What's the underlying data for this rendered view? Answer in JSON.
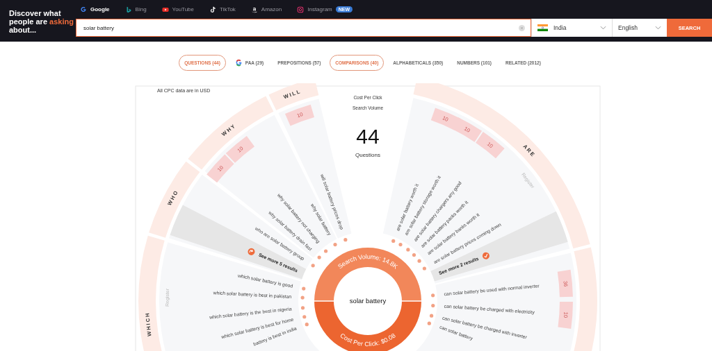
{
  "header": {
    "tagline": {
      "before": "Discover what people are ",
      "highlight": "asking",
      "after": " about..."
    },
    "engines": [
      {
        "label": "Google",
        "kind": "google",
        "selected": true
      },
      {
        "label": "Bing",
        "kind": "bing",
        "selected": false
      },
      {
        "label": "YouTube",
        "kind": "youtube",
        "selected": false
      },
      {
        "label": "TikTok",
        "kind": "tiktok",
        "selected": false
      },
      {
        "label": "Amazon",
        "kind": "amazon",
        "selected": false
      },
      {
        "label": "Instagram",
        "kind": "instagram",
        "selected": false,
        "badge": "NEW"
      }
    ],
    "search": {
      "value": "solar battery"
    },
    "country": "India",
    "language": "English",
    "search_button": "SEARCH"
  },
  "tabs": [
    {
      "label": "QUESTIONS (44)",
      "kind": "plain",
      "selected": true
    },
    {
      "label": "PAA (29)",
      "kind": "google",
      "selected": false
    },
    {
      "label": "PREPOSITIONS (57)",
      "kind": "plain",
      "selected": false
    },
    {
      "label": "COMPARISONS (40)",
      "kind": "plain",
      "selected": true
    },
    {
      "label": "ALPHABETICALS (350)",
      "kind": "plain",
      "selected": false
    },
    {
      "label": "NUMBERS (101)",
      "kind": "plain",
      "selected": false
    },
    {
      "label": "RELATED (2012)",
      "kind": "plain",
      "selected": false
    }
  ],
  "wheel": {
    "note": "All CPC data are in USD",
    "legend": [
      "Cost Per Click",
      "Search Volume"
    ],
    "count": "44",
    "count_label": "Questions",
    "center": {
      "keyword": "solar battery",
      "search_volume": "Search Volume: 14.8K",
      "cpc": "Cost Per Click: $0.08"
    },
    "groups": [
      {
        "label": "WILL",
        "items": [
          {
            "kind": "question",
            "text": "will solar battery prices drop",
            "volume": "10"
          }
        ]
      },
      {
        "label": "WHY",
        "items": [
          {
            "kind": "question",
            "text": "why solar battery"
          },
          {
            "kind": "question",
            "text": "why solar battery not charging",
            "volume": "10"
          },
          {
            "kind": "question",
            "text": "why solar battery drain fast",
            "volume": "10"
          }
        ]
      },
      {
        "label": "WHO",
        "items": [
          {
            "kind": "question",
            "text": "who are solar battery group"
          },
          {
            "kind": "see_more",
            "text": "See more 5 results"
          }
        ]
      },
      {
        "label": "WHICH",
        "register": "Register",
        "items": [
          {
            "kind": "question",
            "text": "which solar battery is good"
          },
          {
            "kind": "question",
            "text": "which solar battery is best in pakistan"
          },
          {
            "kind": "question",
            "text": "which solar battery is the best in nigeria"
          },
          {
            "kind": "question",
            "text": "which solar battery is best for home"
          },
          {
            "kind": "question",
            "text": "battery is best in india"
          }
        ]
      },
      {
        "label": "ARE",
        "register": "Register",
        "items": [
          {
            "kind": "question",
            "text": "are solar battery worth it",
            "volume": "10"
          },
          {
            "kind": "question",
            "text": "are solar battery storage worth it",
            "volume": "10"
          },
          {
            "kind": "question",
            "text": "are solar battery chargers any good",
            "volume": "10"
          },
          {
            "kind": "question",
            "text": "are solar battery packs worth it"
          },
          {
            "kind": "question",
            "text": "are solar battery banks worth it"
          },
          {
            "kind": "question",
            "text": "are solar battery prices coming down"
          },
          {
            "kind": "see_more",
            "text": "See more 2 results"
          }
        ]
      },
      {
        "items": [
          {
            "kind": "question",
            "text": "can solar battery be used with normal inverter",
            "volume": "36"
          },
          {
            "kind": "question",
            "text": "can solar battery be charged with electricity",
            "volume": "10"
          },
          {
            "kind": "question",
            "text": "can solar battery be charged with inverter"
          },
          {
            "kind": "question",
            "text": "can solar battery"
          }
        ]
      }
    ]
  }
}
